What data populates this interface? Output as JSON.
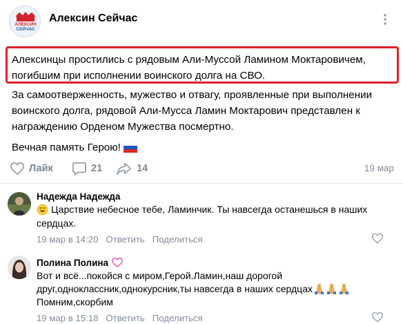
{
  "group": {
    "name": "Алексин Сейчас",
    "avatar_text": [
      "АЛЕКСИН",
      "СЕЙЧАС"
    ],
    "avatar_color": "#d2232a"
  },
  "post": {
    "highlight_color": "#e0202a",
    "lines": [
      "Алексинцы простились с рядовым Али-Муссой Ламином Моктаровичем,",
      "погибшим при исполнении воинского долга на СВО.",
      "За самоотверженность, мужество и отвагу, проявленные при выполнении",
      "воинского долга, рядовой Али-Мусса Ламин Моктарович представлен к",
      "награждению Орденом Мужества посмертно.",
      "Вечная память Герою!"
    ],
    "flag_emoji": "russia-flag"
  },
  "actions": {
    "like_label": "Лайк",
    "comments_count": "21",
    "shares_count": "14",
    "date": "19 мар"
  },
  "comments": [
    {
      "author": "Надежда Надежда",
      "emoji": "smile-emoji",
      "text_lines": [
        "Царствие небесное тебе, Ламинчик. Ты навсегда останешься в наших",
        "сердцах."
      ],
      "time": "19 мар в 14:20",
      "reply_label": "Ответить",
      "share_label": "Поделиться"
    },
    {
      "author": "Полина Полина",
      "author_badge": "heart-badge-icon",
      "text_lines": [
        "Вот и всё...покойся с миром,Герой.Ламин,наш дорогой",
        "друг,одноклассник,однокурсник,ты навсегда в наших сердцах",
        "Помним,скорбим"
      ],
      "text_emojis": "pray-emoji",
      "time": "19 мар в 15:18",
      "reply_label": "Ответить",
      "share_label": "Поделиться"
    }
  ],
  "colors": {
    "secondary_text": "#818c99",
    "action_icon": "#7c8694"
  }
}
